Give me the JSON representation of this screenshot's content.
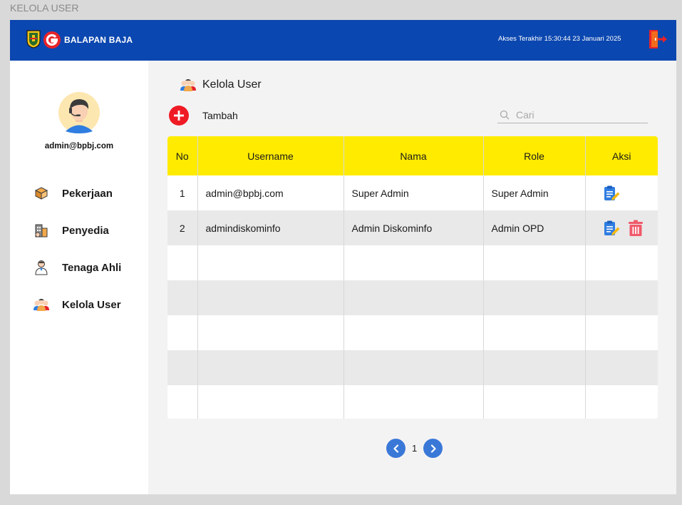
{
  "frame": {
    "title": "KELOLA USER"
  },
  "header": {
    "brand": "BALAPAN BAJA",
    "last_access": "Akses Terakhir 15:30:44 23 Januari 2025"
  },
  "sidebar": {
    "user_email": "admin@bpbj.com",
    "items": [
      {
        "label": "Pekerjaan",
        "icon": "box-icon"
      },
      {
        "label": "Penyedia",
        "icon": "building-icon"
      },
      {
        "label": "Tenaga Ahli",
        "icon": "expert-icon"
      },
      {
        "label": "Kelola User",
        "icon": "users-icon"
      }
    ]
  },
  "main": {
    "title": "Kelola User",
    "add_label": "Tambah",
    "search_placeholder": "Cari",
    "table": {
      "headers": [
        "No",
        "Username",
        "Nama",
        "Role",
        "Aksi"
      ],
      "rows": [
        {
          "no": "1",
          "username": "admin@bpbj.com",
          "nama": "Super Admin",
          "role": "Super Admin"
        },
        {
          "no": "2",
          "username": "admindiskominfo",
          "nama": "Admin Diskominfo",
          "role": "Admin OPD"
        }
      ]
    },
    "pagination": {
      "current": "1"
    }
  },
  "colors": {
    "header_bg": "#0b47b0",
    "table_header": "#ffeb00",
    "add_button": "#ef1b24",
    "pager": "#3a78d8",
    "delete": "#f05a6a",
    "edit": "#2f7de1"
  }
}
